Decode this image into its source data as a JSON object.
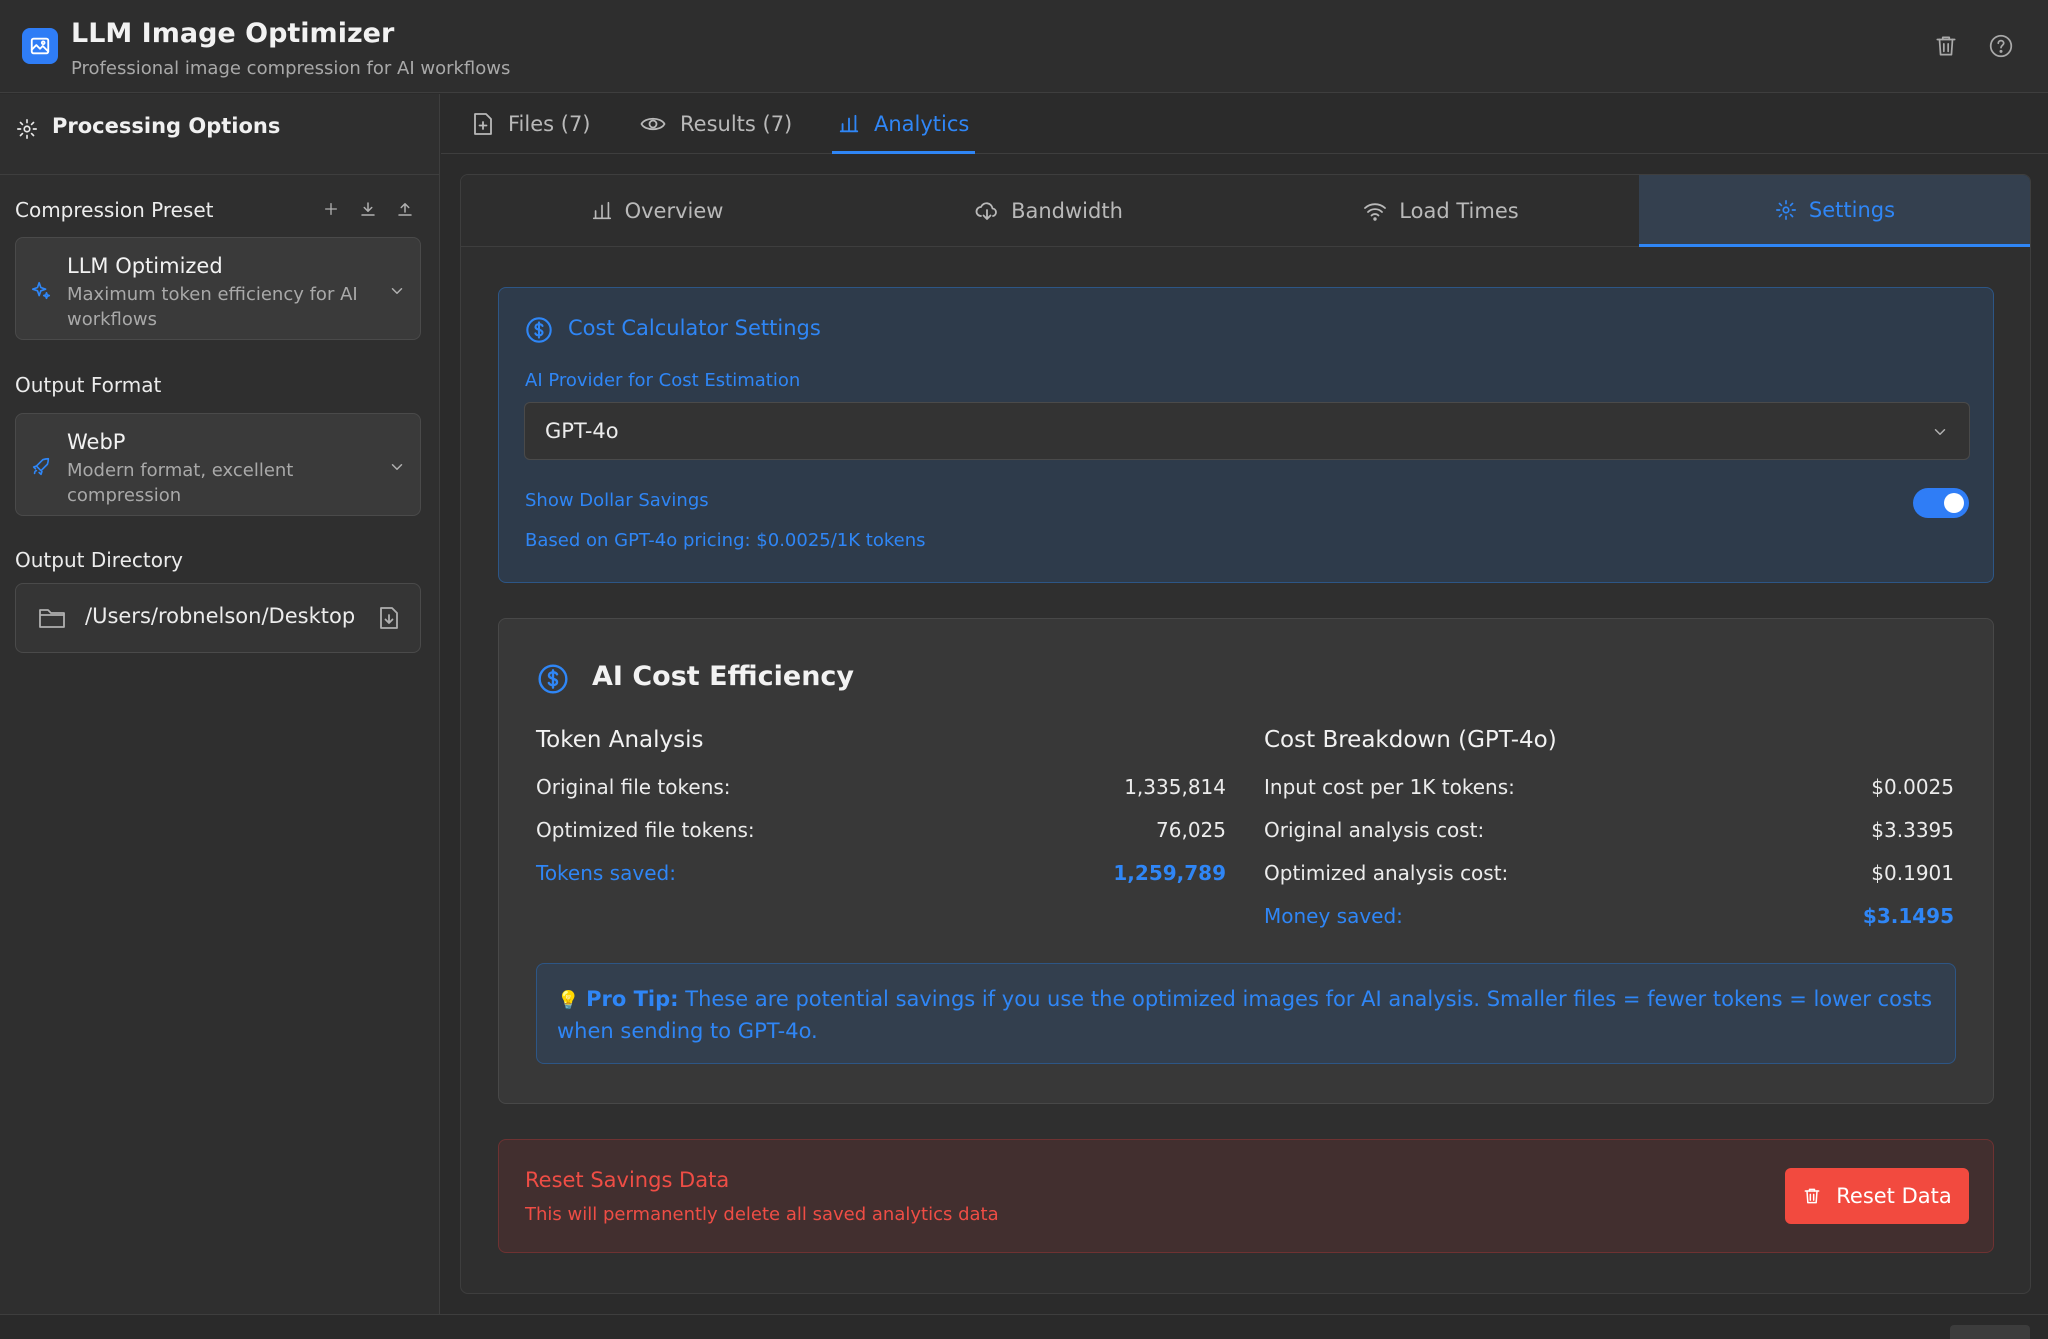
{
  "header": {
    "title": "LLM Image Optimizer",
    "subtitle": "Professional image compression for AI workflows"
  },
  "sidebar": {
    "title": "Processing Options",
    "compression_preset": {
      "label": "Compression Preset",
      "name": "LLM Optimized",
      "description": "Maximum token efficiency for AI workflows"
    },
    "output_format": {
      "label": "Output Format",
      "name": "WebP",
      "description": "Modern format, excellent compression"
    },
    "output_directory": {
      "label": "Output Directory",
      "path": "/Users/robnelson/Desktop"
    }
  },
  "tabs": [
    {
      "label": "Files (7)"
    },
    {
      "label": "Results (7)"
    },
    {
      "label": "Analytics"
    }
  ],
  "subtabs": [
    {
      "label": "Overview"
    },
    {
      "label": "Bandwidth"
    },
    {
      "label": "Load Times"
    },
    {
      "label": "Settings"
    }
  ],
  "cost_settings": {
    "title": "Cost Calculator Settings",
    "provider_label": "AI Provider for Cost Estimation",
    "provider_value": "GPT-4o",
    "show_savings_label": "Show Dollar Savings",
    "show_savings_enabled": true,
    "pricing_note": "Based on GPT-4o pricing: $0.0025/1K tokens"
  },
  "efficiency": {
    "title": "AI Cost Efficiency",
    "token_analysis": {
      "title": "Token Analysis",
      "rows": [
        {
          "label": "Original file tokens:",
          "value": "1,335,814"
        },
        {
          "label": "Optimized file tokens:",
          "value": "76,025"
        },
        {
          "label": "Tokens saved:",
          "value": "1,259,789"
        }
      ]
    },
    "cost_breakdown": {
      "title": "Cost Breakdown (GPT-4o)",
      "rows": [
        {
          "label": "Input cost per 1K tokens:",
          "value": "$0.0025"
        },
        {
          "label": "Original analysis cost:",
          "value": "$3.3395"
        },
        {
          "label": "Optimized analysis cost:",
          "value": "$0.1901"
        },
        {
          "label": "Money saved:",
          "value": "$3.1495"
        }
      ]
    },
    "tip": {
      "icon": "💡",
      "label": "Pro Tip:",
      "text": "These are potential savings if you use the optimized images for AI analysis. Smaller files = fewer tokens = lower costs when sending to GPT-4o."
    }
  },
  "reset": {
    "title": "Reset Savings Data",
    "description": "This will permanently delete all saved analytics data",
    "button_label": "Reset Data"
  },
  "colors": {
    "accent": "#2f86f6",
    "danger": "#f24a3f",
    "background": "#2b2b2b"
  }
}
